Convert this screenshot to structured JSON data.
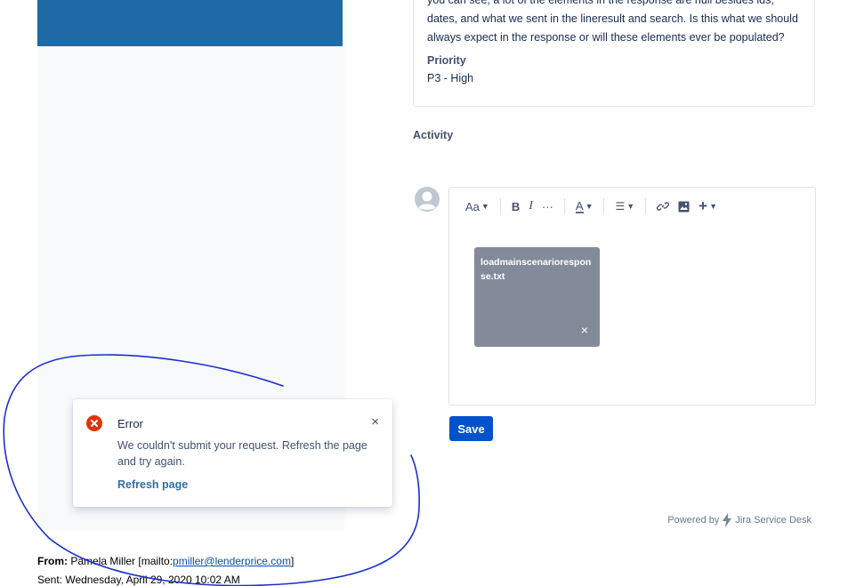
{
  "description": {
    "text": "you can see, a lot of the elements in the response are null besides ids, dates, and what we sent in the lineresult and search. Is this what we should always expect in the response or will these elements ever be populated?",
    "priority_label": "Priority",
    "priority_value": "P3 - High"
  },
  "activity": {
    "label": "Activity"
  },
  "editor": {
    "toolbar": {
      "text_style": "Aa",
      "bold": "B",
      "italic": "I",
      "more": "···",
      "text_color": "A",
      "list": "☰",
      "add": "+"
    },
    "attachment": {
      "filename": "loadmainscenarioresponse.txt",
      "remove": "×"
    }
  },
  "save_label": "Save",
  "footer": {
    "powered_by": "Powered by",
    "product": "Jira Service Desk"
  },
  "toast": {
    "title": "Error",
    "message": "We couldn't submit your request. Refresh the page and try again.",
    "action": "Refresh page",
    "close": "×"
  },
  "email": {
    "from_label": "From:",
    "from_name": "Pamela Miller [mailto:",
    "from_email": "pmiller@lenderprice.com",
    "from_end": "]",
    "sent_text": "Sent: Wednesday, April 29, 2020 10:02 AM"
  },
  "colors": {
    "accent": "#0052cc",
    "header": "#1f6aa5",
    "error": "#de350b",
    "annotation": "#1a2fd1"
  }
}
